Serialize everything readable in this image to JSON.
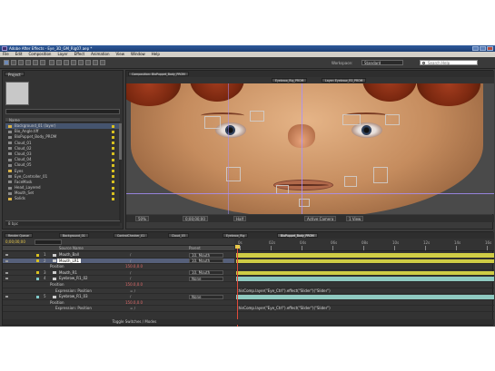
{
  "window": {
    "title": "Adobe After Effects - Eye_3D_GM_Rig07.aep *"
  },
  "menu": [
    "File",
    "Edit",
    "Composition",
    "Layer",
    "Effect",
    "Animation",
    "View",
    "Window",
    "Help"
  ],
  "toolbar": {
    "workspace_label": "Workspace:",
    "workspace_value": "Standard",
    "search_placeholder": "Search Help"
  },
  "project": {
    "tab": "Project",
    "column_name": "Name",
    "items": [
      {
        "name": "Background_01 (layer)",
        "type": "folder",
        "selected": true
      },
      {
        "name": "Bio_Angle.tiff",
        "type": "file"
      },
      {
        "name": "BioPuppet_Body_PROM",
        "type": "file"
      },
      {
        "name": "Cloud_01",
        "type": "file"
      },
      {
        "name": "Cloud_02",
        "type": "file"
      },
      {
        "name": "Cloud_03",
        "type": "file"
      },
      {
        "name": "Cloud_04",
        "type": "file"
      },
      {
        "name": "Cloud_05",
        "type": "file"
      },
      {
        "name": "Eyes",
        "type": "folder"
      },
      {
        "name": "Eye_Controller_01",
        "type": "file"
      },
      {
        "name": "FaceMask",
        "type": "file"
      },
      {
        "name": "Head_Layered",
        "type": "file"
      },
      {
        "name": "Mouth_Set",
        "type": "file"
      },
      {
        "name": "Solids",
        "type": "folder"
      }
    ],
    "footer": "8 bpc"
  },
  "viewer": {
    "tabs": [
      "Composition: BioPuppet_Body_PROM",
      "Eyebrow_Rig_PROM",
      "Layer: Eyebrow_R3_PROM"
    ],
    "zoom": "50%",
    "timecode": "0;00;00;00",
    "resolution": "Half",
    "camera": "Active Camera",
    "view": "1 View"
  },
  "timeline": {
    "tabs": [
      "Render Queue",
      "Background_01",
      "ControlChecker_01",
      "Cloud_03",
      "Eyebrow_Rig",
      "BioPuppet_Body_PROM"
    ],
    "active_tab": 5,
    "timecode": "0;00;00;00",
    "header": {
      "source": "Source Name",
      "parent": "Parent"
    },
    "ruler": [
      "0s",
      "02s",
      "04s",
      "06s",
      "08s",
      "10s",
      "12s",
      "14s",
      "16s"
    ],
    "layers": [
      {
        "num": "1",
        "name": "Mouth_Ball",
        "parent": "10. Mouth",
        "label": "#d8c020",
        "kind": "layer"
      },
      {
        "num": "2",
        "name": "Mouth_LR1",
        "parent": "10. Mouth",
        "label": "#d8c020",
        "kind": "layer",
        "selected": true,
        "editing": true
      },
      {
        "name": "Position",
        "kind": "prop",
        "value": "150.0,0.0"
      },
      {
        "num": "3",
        "name": "Mouth_R1",
        "parent": "10. Mouth",
        "label": "#d8c020",
        "kind": "layer"
      },
      {
        "num": "4",
        "name": "Eyebrow_R1_02",
        "parent": "None",
        "label": "#7fc9c9",
        "kind": "layer"
      },
      {
        "name": "Position",
        "kind": "prop",
        "value": "150.0,0.0"
      },
      {
        "name": "Expression: Position",
        "kind": "expr"
      },
      {
        "num": "5",
        "name": "Eyebrow_R1_03",
        "parent": "None",
        "label": "#7fc9c9",
        "kind": "layer"
      },
      {
        "name": "Position",
        "kind": "prop",
        "value": "150.0,0.0"
      },
      {
        "name": "Expression: Position",
        "kind": "expr"
      }
    ],
    "expressions": [
      "thisComp.layer(\"Eye_Ctrl\").effect(\"Slider\")(\"Slider\")",
      "thisComp.layer(\"Eye_Ctrl\").effect(\"Slider\")(\"Slider\")"
    ],
    "toggle_label": "Toggle Switches / Modes"
  },
  "colors": {
    "cti": "#e04a3a",
    "yellow_track": "#cfcc45",
    "teal_track": "#8fc9c0",
    "bg": "#3c3c3c"
  }
}
